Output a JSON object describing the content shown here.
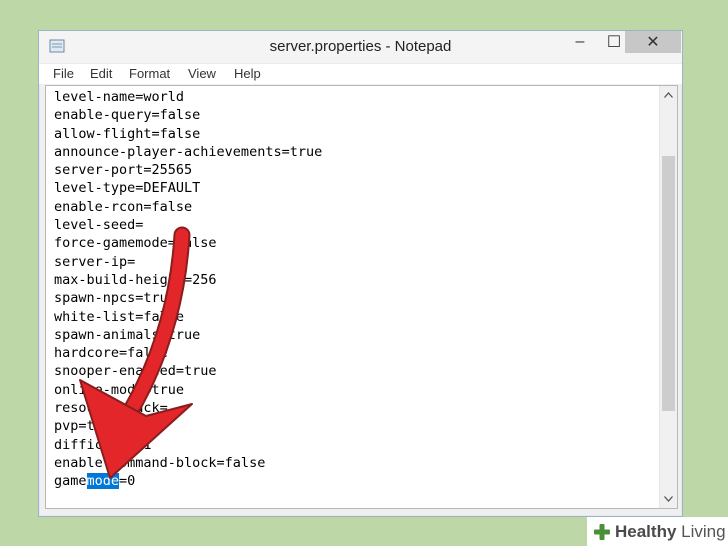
{
  "window": {
    "title": "server.properties - Notepad",
    "controls": {
      "minimize": "–",
      "maximize": "☐",
      "close": "✕"
    }
  },
  "menu": [
    "File",
    "Edit",
    "Format",
    "View",
    "Help"
  ],
  "editor": {
    "lines": [
      "level-name=world",
      "enable-query=false",
      "allow-flight=false",
      "announce-player-achievements=true",
      "server-port=25565",
      "level-type=DEFAULT",
      "enable-rcon=false",
      "level-seed=",
      "force-gamemode=false",
      "server-ip=",
      "max-build-height=256",
      "spawn-npcs=true",
      "white-list=false",
      "spawn-animals=true",
      "hardcore=false",
      "snooper-enabled=true",
      "online-mode=true",
      "resource-pack=",
      "pvp=true",
      "difficulty=1",
      "enable-command-block=false"
    ],
    "last_line": {
      "before": "game",
      "selected": "mode",
      "after": "=0"
    }
  },
  "colors": {
    "background": "#bdd7a7",
    "selection": "#0078d7",
    "arrow": "#e3262a"
  },
  "watermark": {
    "brand_bold": "Healthy",
    "brand_rest": " Living"
  }
}
